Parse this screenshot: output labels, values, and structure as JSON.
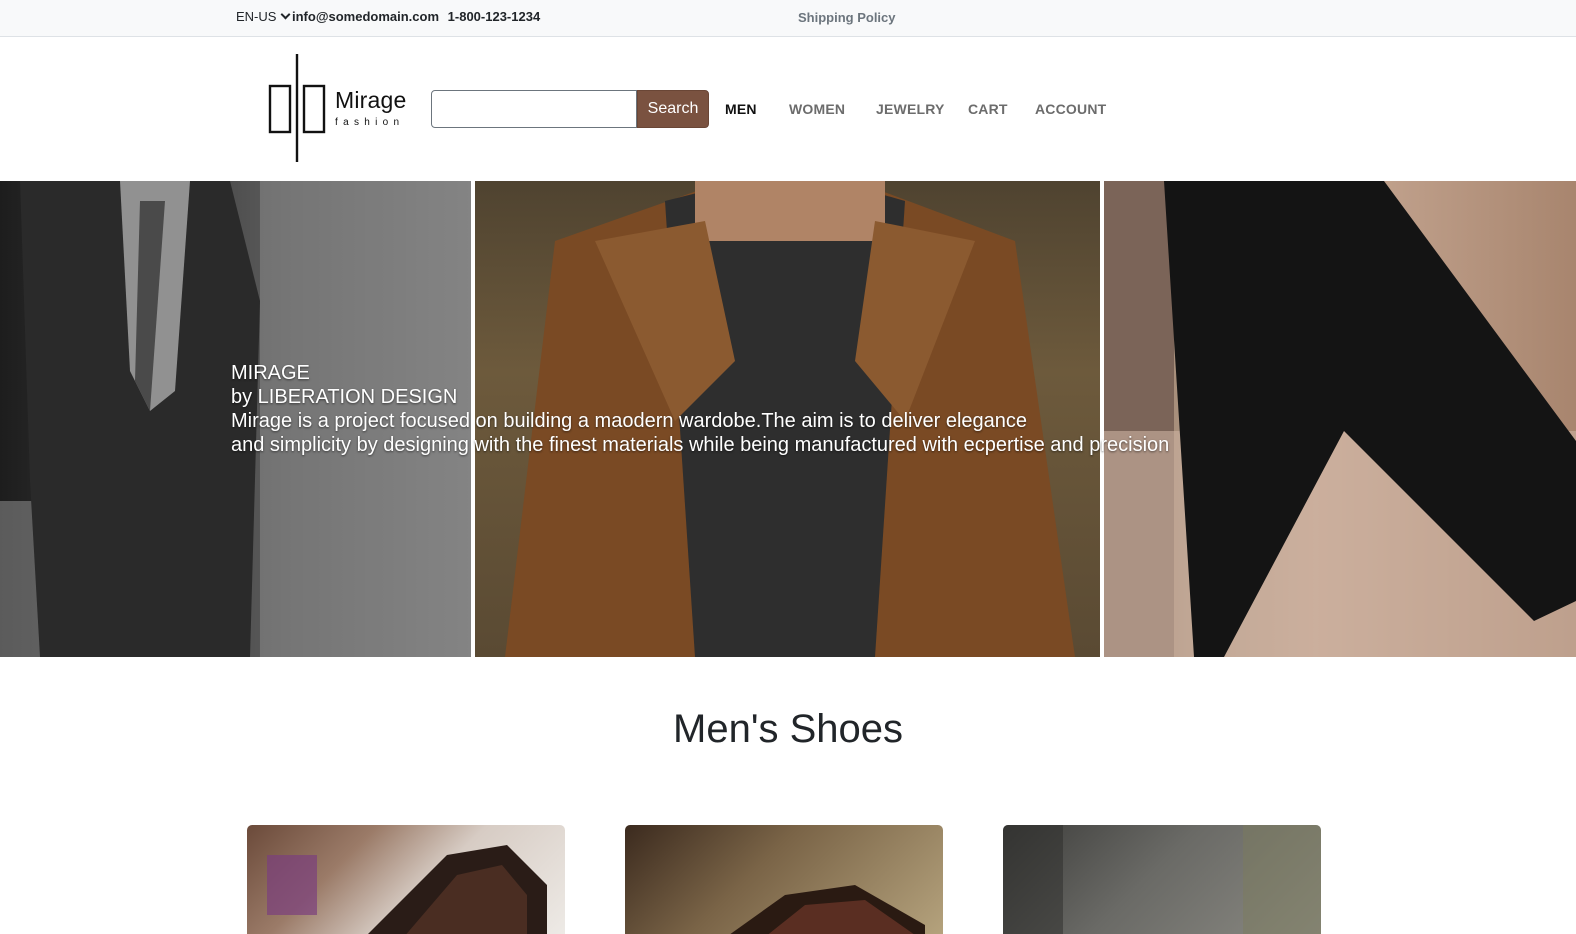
{
  "topbar": {
    "language": "EN-US",
    "email": "info@somedomain.com",
    "phone": "1-800-123-1234",
    "shipping_link": "Shipping Policy"
  },
  "brand": {
    "name": "Mirage",
    "tagline": "fashion"
  },
  "search": {
    "value": "",
    "placeholder": "",
    "button_label": "Search"
  },
  "nav": {
    "items": [
      {
        "label": "MEN",
        "active": true
      },
      {
        "label": "WOMEN",
        "active": false
      },
      {
        "label": "JEWELRY",
        "active": false
      },
      {
        "label": "CART",
        "active": false
      },
      {
        "label": "ACCOUNT",
        "active": false
      }
    ]
  },
  "hero": {
    "line1": "MIRAGE",
    "line2": "by LIBERATION DESIGN",
    "line3": "Mirage is a project focused on building a maodern wardobe.The aim is to deliver elegance",
    "line4": "and simplicity by designing with the finest materials while being manufactured with ecpertise and precision"
  },
  "section": {
    "title": "Men's Shoes"
  },
  "colors": {
    "search_button": "#7a5240",
    "topbar_bg": "#f8f9fa",
    "nav_active": "#111111",
    "nav_idle": "#6c6c6c"
  }
}
